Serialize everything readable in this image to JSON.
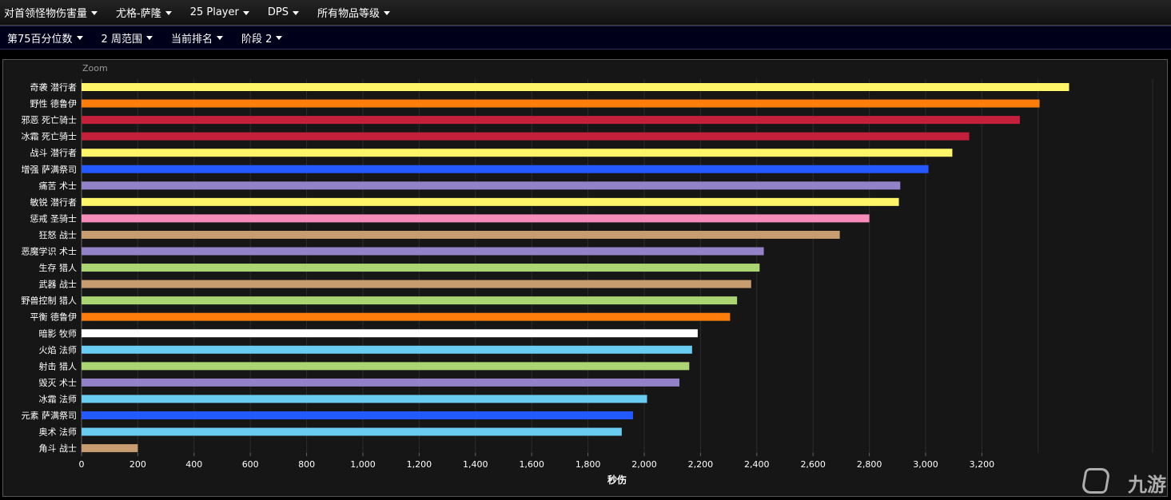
{
  "filters_row1": [
    {
      "label": "对首领怪物伤害量"
    },
    {
      "label": "尤格-萨隆"
    },
    {
      "label": "25 Player"
    },
    {
      "label": "DPS"
    },
    {
      "label": "所有物品等级"
    }
  ],
  "filters_row2": [
    {
      "label": "第75百分位数"
    },
    {
      "label": "2 周范围"
    },
    {
      "label": "当前排名"
    },
    {
      "label": "阶段 2"
    }
  ],
  "zoom_label": "Zoom",
  "watermark": {
    "text": "九游"
  },
  "chart_data": {
    "type": "bar",
    "orientation": "horizontal",
    "xlabel": "秒伤",
    "xlim": [
      0,
      3400
    ],
    "x_ticks": [
      0,
      200,
      400,
      600,
      800,
      1000,
      1200,
      1400,
      1600,
      1800,
      2000,
      2200,
      2400,
      2600,
      2800,
      3000,
      3200
    ],
    "x_tick_labels": [
      "0",
      "200",
      "400",
      "600",
      "800",
      "1,000",
      "1,200",
      "1,400",
      "1,600",
      "1,800",
      "2,000",
      "2,200",
      "2,400",
      "2,600",
      "2,800",
      "3,000",
      "3,200"
    ],
    "grid": true,
    "categories": [
      "奇袭 潜行者",
      "野性 德鲁伊",
      "邪恶 死亡骑士",
      "冰霜 死亡骑士",
      "战斗 潜行者",
      "增强 萨满祭司",
      "痛苦 术士",
      "敏锐 潜行者",
      "惩戒 圣骑士",
      "狂怒 战士",
      "恶魔学识 术士",
      "生存 猎人",
      "武器 战士",
      "野兽控制 猎人",
      "平衡 德鲁伊",
      "暗影 牧师",
      "火焰 法师",
      "射击 猎人",
      "毁灭 术士",
      "冰霜 法师",
      "元素 萨满祭司",
      "奥术 法师",
      "角斗 战士"
    ],
    "values": [
      3510,
      3405,
      3335,
      3155,
      3095,
      3010,
      2910,
      2905,
      2800,
      2695,
      2425,
      2410,
      2380,
      2330,
      2305,
      2190,
      2170,
      2160,
      2125,
      2010,
      1960,
      1920,
      200
    ],
    "colors": [
      "#fff569",
      "#ff7d0a",
      "#c41f3b",
      "#c41f3b",
      "#fff569",
      "#2459ff",
      "#9482c9",
      "#fff569",
      "#f58cba",
      "#c79c6e",
      "#9482c9",
      "#abd473",
      "#c79c6e",
      "#abd473",
      "#ff7d0a",
      "#ffffff",
      "#69ccf0",
      "#abd473",
      "#9482c9",
      "#69ccf0",
      "#2459ff",
      "#69ccf0",
      "#c79c6e"
    ]
  }
}
